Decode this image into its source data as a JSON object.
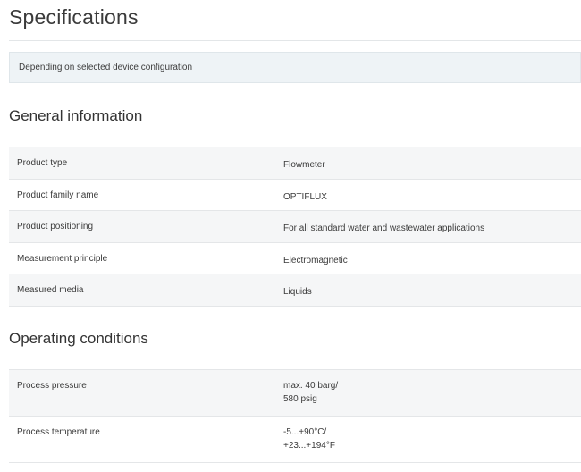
{
  "page": {
    "title": "Specifications",
    "notice": "Depending on selected device configuration"
  },
  "sections": [
    {
      "title": "General information",
      "rows": [
        {
          "label": "Product type",
          "value": [
            "Flowmeter"
          ]
        },
        {
          "label": "Product family name",
          "value": [
            "OPTIFLUX"
          ]
        },
        {
          "label": "Product positioning",
          "value": [
            "For all standard water and wastewater applications"
          ]
        },
        {
          "label": "Measurement principle",
          "value": [
            "Electromagnetic"
          ]
        },
        {
          "label": "Measured media",
          "value": [
            "Liquids"
          ]
        }
      ]
    },
    {
      "title": "Operating conditions",
      "rows": [
        {
          "label": "Process pressure",
          "value": [
            "max. 40 barg/",
            "580 psig"
          ]
        },
        {
          "label": "Process temperature",
          "value": [
            "-5...+90°C/",
            "+23...+194°F"
          ]
        }
      ]
    }
  ],
  "colors": {
    "row_shade": "#f5f6f7",
    "notice_bg": "#eef3f6",
    "divider": "#e4e6e8"
  }
}
